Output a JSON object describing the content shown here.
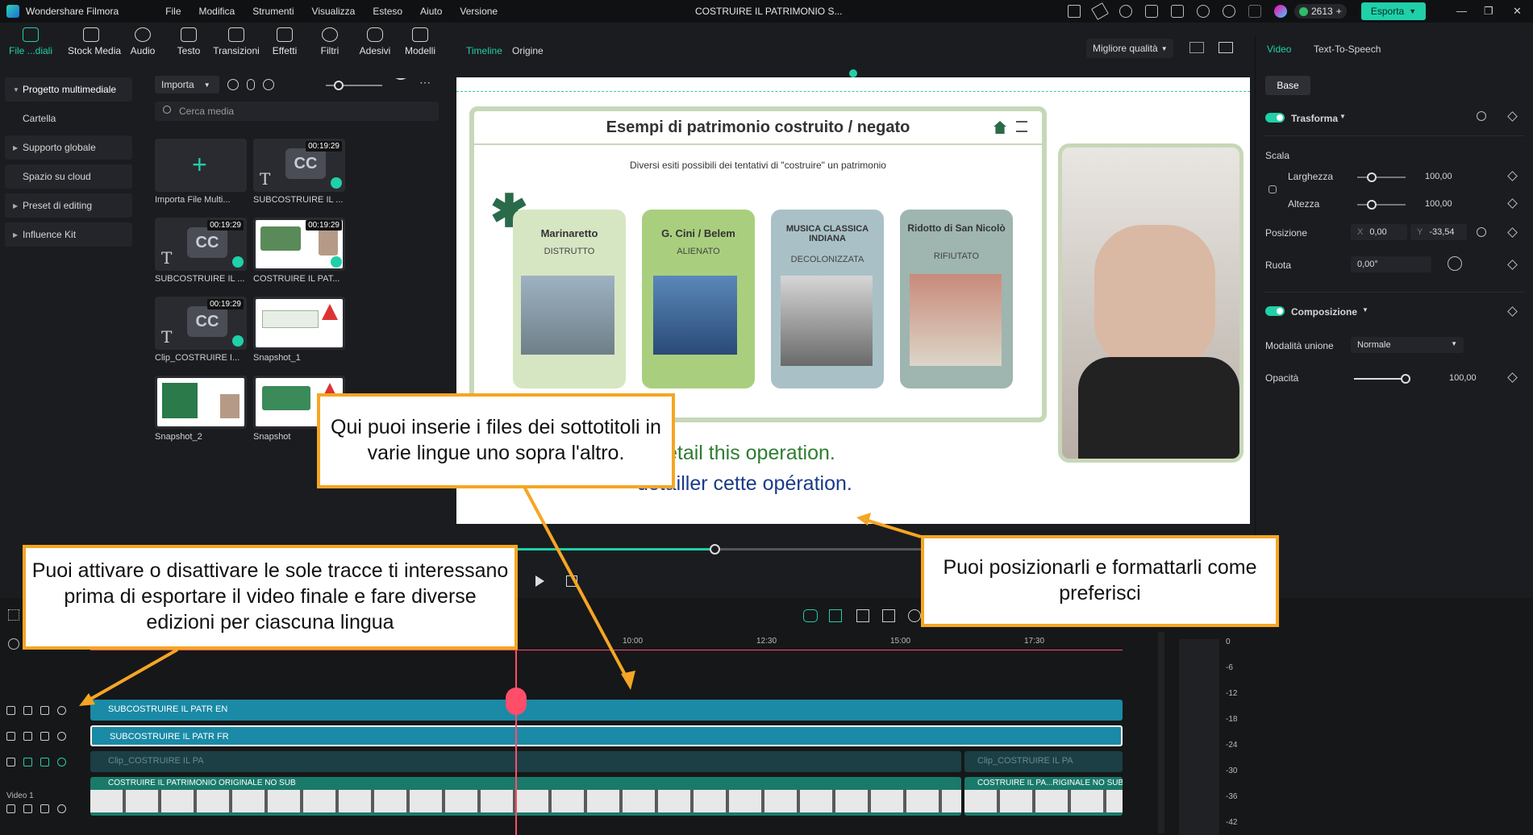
{
  "app": {
    "name": "Wondershare Filmora",
    "project_title": "COSTRUIRE IL PATRIMONIO S...",
    "menu": [
      "File",
      "Modifica",
      "Strumenti",
      "Visualizza",
      "Esteso",
      "Aiuto",
      "Versione"
    ],
    "credits": "2613",
    "export_label": "Esporta"
  },
  "toolbar": {
    "items": [
      "File ...diali",
      "Stock Media",
      "Audio",
      "Testo",
      "Transizioni",
      "Effetti",
      "Filtri",
      "Adesivi",
      "Modelli"
    ]
  },
  "sidebar": {
    "items": [
      "Progetto multimediale",
      "Cartella",
      "Supporto globale",
      "Spazio su cloud",
      "Preset di editing",
      "Influence Kit"
    ]
  },
  "media": {
    "import_label": "Importa",
    "search_placeholder": "Cerca media",
    "items": [
      {
        "caption": "Importa File Multi...",
        "duration": ""
      },
      {
        "caption": "SUBCOSTRUIRE IL ...",
        "duration": "00:19:29"
      },
      {
        "caption": "SUBCOSTRUIRE IL ...",
        "duration": "00:19:29"
      },
      {
        "caption": "COSTRUIRE IL PAT...",
        "duration": "00:19:29"
      },
      {
        "caption": "Clip_COSTRUIRE I...",
        "duration": "00:19:29"
      },
      {
        "caption": "Snapshot_1",
        "duration": ""
      },
      {
        "caption": "Snapshot_2",
        "duration": ""
      },
      {
        "caption": "Snapshot",
        "duration": ""
      }
    ]
  },
  "preview": {
    "tabs": [
      "Timeline",
      "Origine"
    ],
    "quality": "Migliore qualità",
    "slide": {
      "title": "Esempi di patrimonio costruito / negato",
      "subtitle": "Diversi esiti possibili dei tentativi di \"costruire\" un patrimonio",
      "cards": [
        {
          "title": "Marinaretto",
          "status": "DISTRUTTO"
        },
        {
          "title": "G. Cini / Belem",
          "status": "ALIENATO"
        },
        {
          "title": "MUSICA CLASSICA INDIANA",
          "status": "DECOLONIZZATA"
        },
        {
          "title": "Ridotto di San Nicolò",
          "status": "RIFIUTATO"
        }
      ]
    },
    "subtitle_en": "etail this operation.",
    "subtitle_fr": "détailler cette opération."
  },
  "inspector": {
    "tabs": [
      "Video",
      "Text-To-Speech"
    ],
    "subtab": "Base",
    "transform_label": "Trasforma",
    "scale_label": "Scala",
    "width_label": "Larghezza",
    "width_value": "100,00",
    "height_label": "Altezza",
    "height_value": "100,00",
    "position_label": "Posizione",
    "pos_x_label": "X",
    "pos_x": "0,00",
    "pos_y_label": "Y",
    "pos_y": "-33,54",
    "rotate_label": "Ruota",
    "rotate_value": "0,00°",
    "composition_label": "Composizione",
    "blend_label": "Modalità unione",
    "blend_value": "Normale",
    "opacity_label": "Opacità",
    "opacity_value": "100,00",
    "scale_fraction": 0.3,
    "opacity_fraction": 1.0
  },
  "timeline": {
    "ticks": [
      "10:00",
      "12:30",
      "15:00",
      "17:30"
    ],
    "tracks": [
      {
        "label": "SUBCOSTRUIRE IL PATR EN",
        "color": "#1a8aa6"
      },
      {
        "label": "SUBCOSTRUIRE IL PATR FR",
        "color": "#1a8aa6"
      },
      {
        "label": "Clip_COSTRUIRE IL PA",
        "label2": "Clip_COSTRUIRE IL PA",
        "color": "#1d4a50"
      },
      {
        "label": "COSTRUIRE IL PATRIMONIO ORIGINALE NO SUB",
        "label2": "COSTRUIRE IL PA...RIGINALE NO SUB",
        "color": "#1a7a6a"
      }
    ],
    "video_label": "Video 1",
    "meter": [
      "0",
      "-6",
      "-12",
      "-18",
      "-24",
      "-30",
      "-36",
      "-42"
    ]
  },
  "callouts": {
    "subtitles": "Qui puoi inserie i files dei sottotitoli in varie lingue uno sopra l'altro.",
    "tracks": "Puoi attivare o disattivare le sole tracce ti interessano prima di esportare il video finale e fare diverse edizioni per ciascuna lingua",
    "position": "Puoi posizionarli e formattarli come preferisci"
  }
}
